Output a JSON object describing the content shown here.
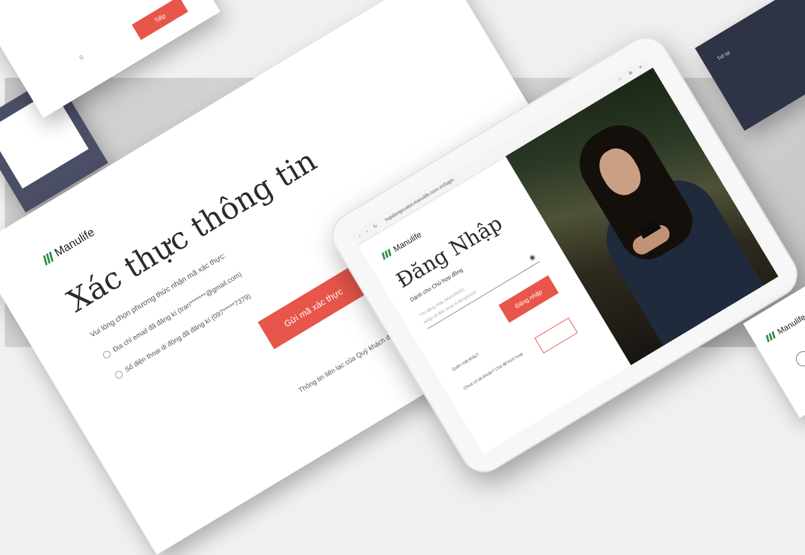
{
  "brand": {
    "name": "Manulife",
    "accent_color": "#e8554a",
    "logo_color": "#2e8b47"
  },
  "card_a": {
    "button_label": "Tiếp",
    "small_text": "Q"
  },
  "verification": {
    "title": "Xác thực thông tin",
    "subtitle": "Vui lòng chọn phương thức nhận mã xác thực:",
    "option_email": "Địa chỉ email đã đăng kí (tran*******@gmail.com)",
    "option_phone": "Số điện thoại di động đã đăng kí (097*****7379)",
    "send_button": "Gửi mã xác thực",
    "note": "Thông tin liên lạc của Quý khách đã được thay đổi? Vui lòng liên hệ Trung tâm Dịch vụ khách hàng để được hỗ trợ."
  },
  "tablet": {
    "url": "hopdongcuatoi.manulife.com.vn/login",
    "login_title": "Đăng Nhập",
    "login_subtitle": "Dành cho Chủ hợp đồng",
    "field_label": "Tên đăng nhập (ManulifeID)",
    "field_placeholder": "Nhập số điện thoại di động/email",
    "login_button": "Đăng nhập",
    "footer_1": "Quên mật khẩu?",
    "footer_2": "Chưa có tài khoản? Chủ để kích hoạt"
  },
  "card_c": {
    "text": "Trở lại"
  },
  "card_d": {
    "logo": "Manulife"
  }
}
